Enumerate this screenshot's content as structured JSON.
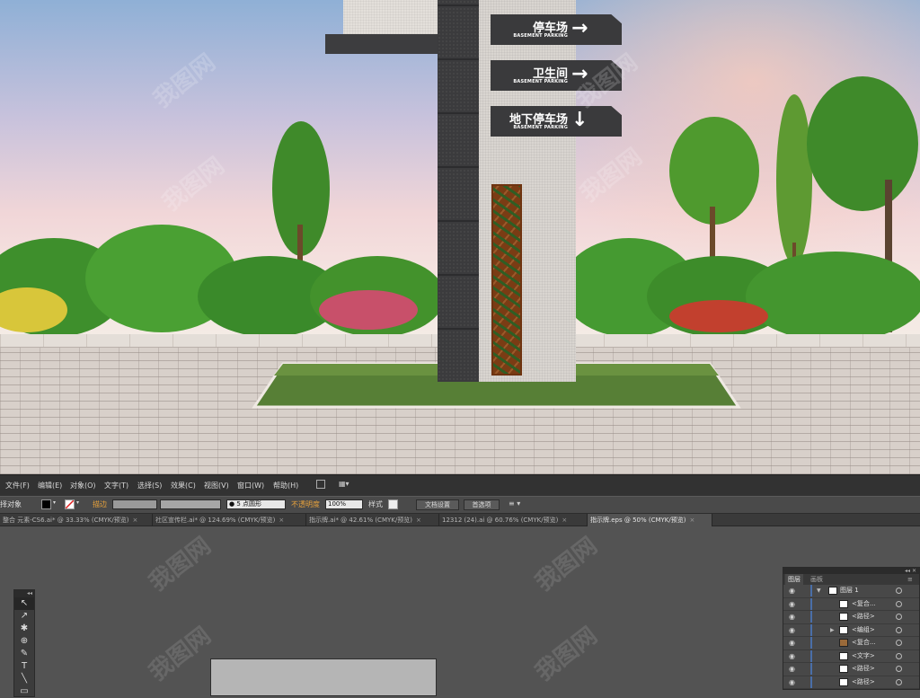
{
  "scene": {
    "signs": [
      {
        "zh": "停车场",
        "en": "BASEMENT PARKING",
        "arrow": "→"
      },
      {
        "zh": "卫生间",
        "en": "BASEMENT PARKING",
        "arrow": "→"
      },
      {
        "zh": "地下停车场",
        "en": "BASEMENT PARKING",
        "arrow": "↓"
      }
    ],
    "watermark": "我图网"
  },
  "menubar": {
    "items": [
      "文件(F)",
      "编辑(E)",
      "对象(O)",
      "文字(T)",
      "选择(S)",
      "效果(C)",
      "视图(V)",
      "窗口(W)",
      "帮助(H)"
    ]
  },
  "controlbar": {
    "selection_label": "择对象",
    "stroke_label": "描边",
    "brush_value": "5 点圆形",
    "opacity_label": "不透明度",
    "opacity_value": "100%",
    "style_label": "样式",
    "doc_setup": "文档设置",
    "preferences": "首选项",
    "colors": {
      "fill": "#000000",
      "stroke_none": "#ffffff",
      "accent_label": "#e8a23c"
    }
  },
  "tabs": [
    {
      "label": "整合 元素-CS6.ai* @ 33.33% (CMYK/预览)",
      "close": "×",
      "active": false
    },
    {
      "label": "社区宣传栏.ai* @ 124.69% (CMYK/预览)",
      "close": "×",
      "active": false
    },
    {
      "label": "指示牌.ai* @ 42.61% (CMYK/预览)",
      "close": "×",
      "active": false
    },
    {
      "label": "12312 (24).ai @ 60.76% (CMYK/预览)",
      "close": "×",
      "active": false
    },
    {
      "label": "指示牌.eps @ 50% (CMYK/预览)",
      "close": "×",
      "active": true
    }
  ],
  "toolbox": {
    "tools": [
      {
        "glyph": "↖",
        "name": "selection-tool"
      },
      {
        "glyph": "↗",
        "name": "direct-selection-tool"
      },
      {
        "glyph": "✱",
        "name": "magic-wand-tool"
      },
      {
        "glyph": "⊕",
        "name": "lasso-tool"
      },
      {
        "glyph": "✎",
        "name": "pen-tool"
      },
      {
        "glyph": "T",
        "name": "type-tool"
      },
      {
        "glyph": "╲",
        "name": "line-tool"
      },
      {
        "glyph": "▭",
        "name": "rectangle-tool"
      }
    ]
  },
  "layers": {
    "tab_active": "图层",
    "tab_other": "画板",
    "rows": [
      {
        "name": "图层 1",
        "level": 0,
        "expanded": true
      },
      {
        "name": "<复合...",
        "level": 1
      },
      {
        "name": "<路径>",
        "level": 1
      },
      {
        "name": "<编组>",
        "level": 1,
        "collapsed": true
      },
      {
        "name": "<复合...",
        "level": 1
      },
      {
        "name": "<文字>",
        "level": 1
      },
      {
        "name": "<路径>",
        "level": 1
      },
      {
        "name": "<路径>",
        "level": 1
      }
    ]
  }
}
